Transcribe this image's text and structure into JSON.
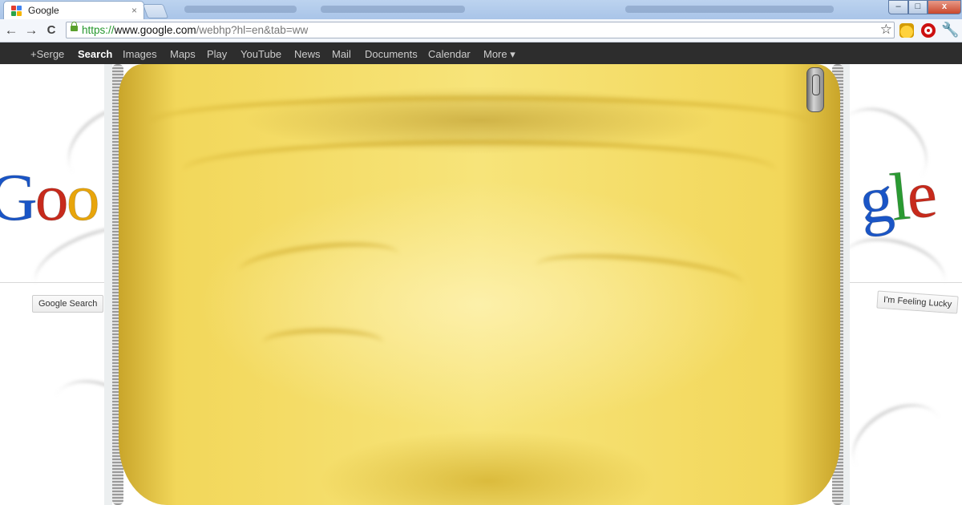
{
  "window": {
    "tab_title": "Google",
    "tab_close": "×",
    "controls": {
      "minimize": "–",
      "maximize": "□",
      "close": "x"
    }
  },
  "toolbar": {
    "back": "←",
    "forward": "→",
    "reload": "C",
    "url_scheme": "https://",
    "url_host": "www.google.com",
    "url_path": "/webhp?hl=en&tab=ww",
    "star": "☆",
    "wrench": "🔧"
  },
  "gbar": {
    "items": [
      "+Serge",
      "Search",
      "Images",
      "Maps",
      "Play",
      "YouTube",
      "News",
      "Mail",
      "Documents",
      "Calendar",
      "More ▾"
    ],
    "selected": "Search"
  },
  "page": {
    "logo_left": [
      "G",
      "o",
      "o"
    ],
    "logo_right": [
      "g",
      "l",
      "e"
    ],
    "search_button": "Google Search",
    "lucky_button": "I'm Feeling Lucky"
  },
  "colors": {
    "google_blue": "#1a55c6",
    "google_red": "#c72a1c",
    "google_yellow": "#e8a50b",
    "google_green": "#2a9a32",
    "shirt_yellow": "#f5df73"
  }
}
